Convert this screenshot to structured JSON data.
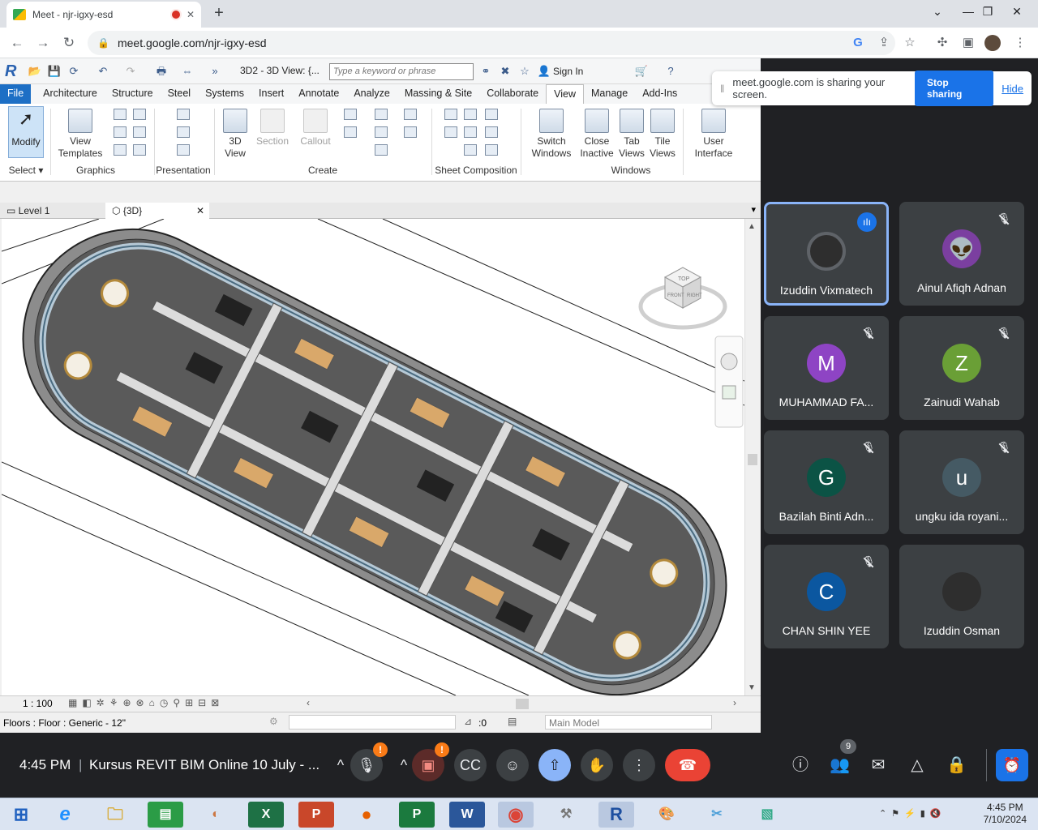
{
  "browser": {
    "tab_title": "Meet - njr-igxy-esd",
    "close_tab": "✕",
    "new_tab": "+",
    "url": "meet.google.com/njr-igxy-esd"
  },
  "revit": {
    "view_title": "3D2 - 3D View: {...",
    "search_placeholder": "Type a keyword or phrase",
    "sign_in": "Sign In",
    "ribbon_tabs": [
      "File",
      "Architecture",
      "Structure",
      "Steel",
      "Systems",
      "Insert",
      "Annotate",
      "Analyze",
      "Massing & Site",
      "Collaborate",
      "View",
      "Manage",
      "Add-Ins"
    ],
    "modify": "Modify",
    "view_templates_1": "View",
    "view_templates_2": "Templates",
    "view_3d_1": "3D",
    "view_3d_2": "View",
    "section": "Section",
    "callout": "Callout",
    "switch_windows_1": "Switch",
    "switch_windows_2": "Windows",
    "close_inactive_1": "Close",
    "close_inactive_2": "Inactive",
    "tab_views_1": "Tab",
    "tab_views_2": "Views",
    "tile_views_1": "Tile",
    "tile_views_2": "Views",
    "user_interface_1": "User",
    "user_interface_2": "Interface",
    "panels": {
      "select": "Select",
      "graphics": "Graphics",
      "presentation": "Presentation",
      "create": "Create",
      "sheet_composition": "Sheet Composition",
      "windows": "Windows"
    },
    "view_tabs": [
      "Level 1",
      "{3D}"
    ],
    "view_tab_close": "✕",
    "scale": "1 : 100",
    "status_text": "Floors : Floor : Generic - 12\"",
    "selection_count": ":0",
    "workset": "Main Model",
    "viewcube_top": "TOP",
    "viewcube_front": "FRONT",
    "viewcube_right": "RIGHT"
  },
  "share_banner": {
    "message": "meet.google.com is sharing your screen.",
    "stop": "Stop sharing",
    "hide": "Hide"
  },
  "participants": [
    {
      "name": "Izuddin Vixmatech",
      "initial": "",
      "color": "#5f6368",
      "speaking": true
    },
    {
      "name": "Ainul Afiqh Adnan",
      "initial": "",
      "color": "#7b3fa0",
      "speaking": false
    },
    {
      "name": "MUHAMMAD FA...",
      "initial": "M",
      "color": "#8e44c4",
      "speaking": false
    },
    {
      "name": "Zainudi Wahab",
      "initial": "Z",
      "color": "#6a9f36",
      "speaking": false
    },
    {
      "name": "Bazilah Binti Adn...",
      "initial": "G",
      "color": "#0b5345",
      "speaking": false
    },
    {
      "name": "ungku ida royani...",
      "initial": "u",
      "color": "#455a64",
      "speaking": false
    },
    {
      "name": "CHAN SHIN YEE",
      "initial": "C",
      "color": "#0b57a0",
      "speaking": false
    },
    {
      "name": "Izuddin Osman",
      "initial": "",
      "color": "#5f6368",
      "speaking": false
    }
  ],
  "meeting": {
    "time": "4:45 PM",
    "title": "Kursus REVIT BIM Online 10 July - ...",
    "people_count": "9",
    "warn": "!"
  },
  "taskbar": {
    "time": "4:45 PM",
    "date": "7/10/2024"
  }
}
